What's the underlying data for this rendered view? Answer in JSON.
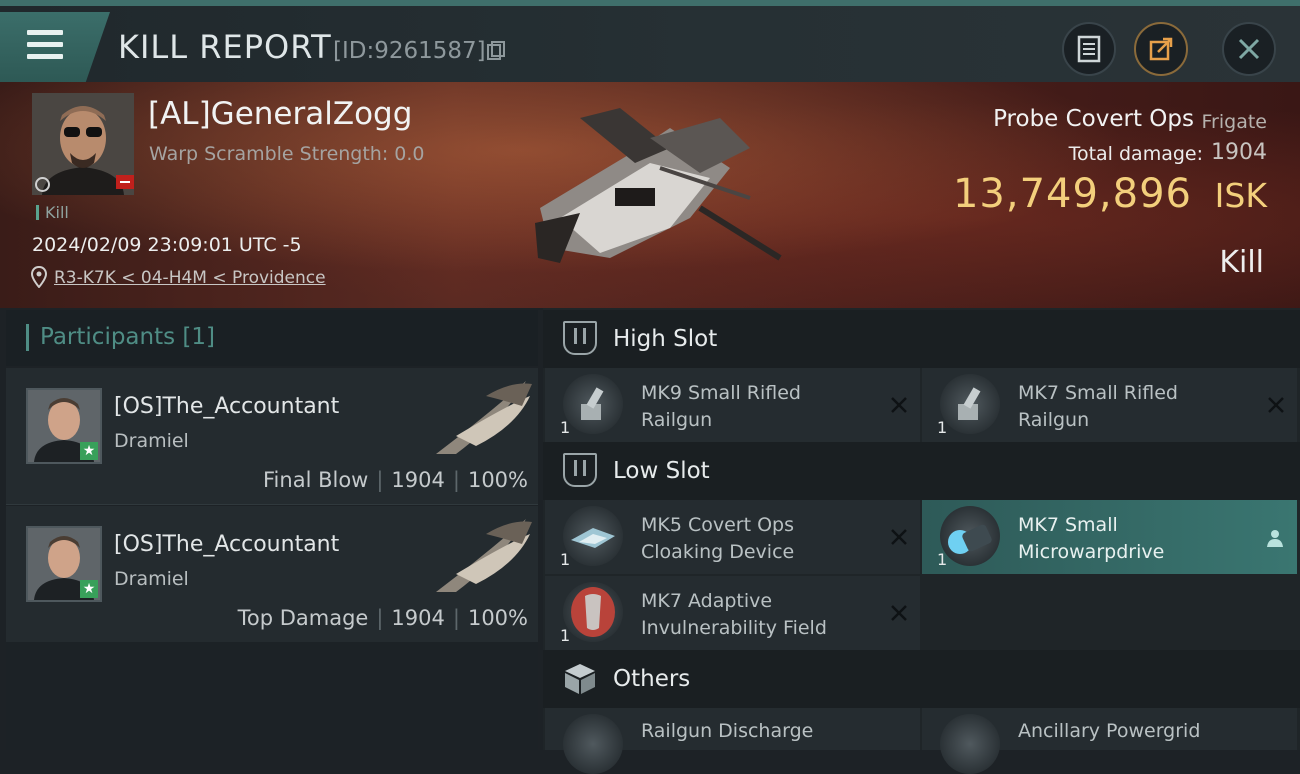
{
  "header": {
    "title": "KILL REPORT",
    "report_id": "[ID:9261587]"
  },
  "victim": {
    "name": "[AL]GeneralZogg",
    "scramble": "Warp Scramble Strength: 0.0",
    "tag": "Kill",
    "datetime": "2024/02/09 23:09:01 UTC -5",
    "location": "R3-K7K < 04-H4M < Providence"
  },
  "ship": {
    "name": "Probe Covert Ops",
    "class": "Frigate",
    "damage_label": "Total damage:",
    "damage_value": "1904",
    "isk_value": "13,749,896",
    "isk_unit": "ISK",
    "result": "Kill"
  },
  "participants": {
    "title": "Participants [1]",
    "items": [
      {
        "name": "[OS]The_Accountant",
        "ship": "Dramiel",
        "role": "Final Blow",
        "damage": "1904",
        "percent": "100%"
      },
      {
        "name": "[OS]The_Accountant",
        "ship": "Dramiel",
        "role": "Top Damage",
        "damage": "1904",
        "percent": "100%"
      }
    ]
  },
  "slots": {
    "high": {
      "label": "High Slot",
      "items": [
        {
          "name": "MK9 Small Rifled Railgun",
          "qty": "1"
        },
        {
          "name": "MK7 Small Rifled Railgun",
          "qty": "1"
        }
      ]
    },
    "low": {
      "label": "Low Slot",
      "items": [
        {
          "name": "MK5 Covert Ops Cloaking Device",
          "qty": "1"
        },
        {
          "name": "MK7 Small Microwarpdrive",
          "qty": "1"
        },
        {
          "name": "MK7 Adaptive Invulnerability Field",
          "qty": "1"
        }
      ]
    },
    "others": {
      "label": "Others",
      "items": [
        {
          "name": "Railgun Discharge"
        },
        {
          "name": "Ancillary Powergrid"
        }
      ]
    }
  },
  "colors": {
    "accent": "#3f6f6b",
    "isk": "#f3cf7c",
    "active_module": "#3a7671"
  }
}
